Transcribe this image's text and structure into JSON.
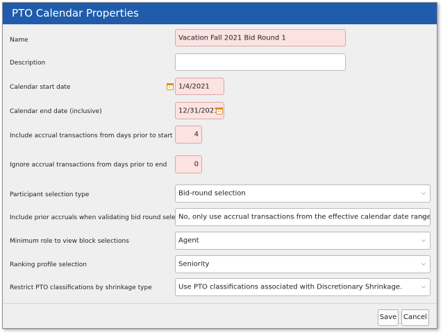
{
  "dialog": {
    "title": "PTO Calendar Properties",
    "buttons": {
      "save": "Save",
      "cancel": "Cancel"
    }
  },
  "fields": {
    "name": {
      "label": "Name",
      "value": "Vacation Fall 2021 Bid Round 1"
    },
    "description": {
      "label": "Description",
      "value": ""
    },
    "start_date": {
      "label": "Calendar start date",
      "value": "1/4/2021",
      "icon": "calendar-icon"
    },
    "end_date": {
      "label": "Calendar end date (inclusive)",
      "value": "12/31/2021",
      "icon": "calendar-icon"
    },
    "accrual_prior_start": {
      "label": "Include accrual transactions from days prior to start",
      "value": "4"
    },
    "accrual_prior_end": {
      "label": "Ignore accrual transactions from days prior to end",
      "value": "0"
    },
    "participant_selection": {
      "label": "Participant selection type",
      "value": "Bid-round selection"
    },
    "prior_accruals": {
      "label": "Include prior accruals when validating bid round selections",
      "value": "No, only use accrual transactions from the effective calendar date range."
    },
    "min_role": {
      "label": "Minimum role to view block selections",
      "value": "Agent"
    },
    "ranking_profile": {
      "label": "Ranking profile selection",
      "value": "Seniority"
    },
    "restrict_pto": {
      "label": "Restrict PTO classifications by shrinkage type",
      "value": "Use PTO classifications associated with Discretionary Shrinkage."
    }
  },
  "colors": {
    "title_bar": "#1f5cab",
    "invalid_field": "#fde2e2",
    "calendar_icon": "#e08b1d"
  }
}
